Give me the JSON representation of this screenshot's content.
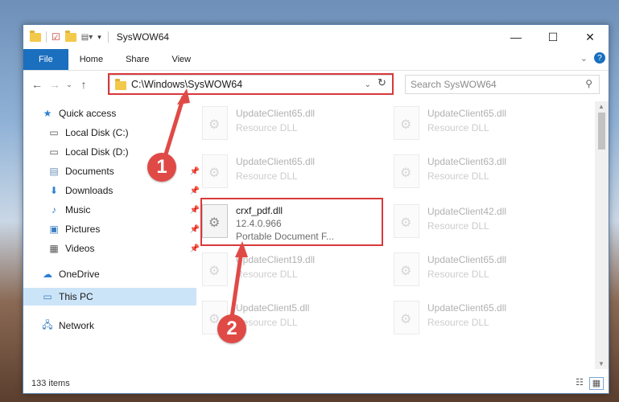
{
  "window": {
    "title": "SysWOW64"
  },
  "ribbon": {
    "tabs": [
      "File",
      "Home",
      "Share",
      "View"
    ]
  },
  "address": {
    "path": "C:\\Windows\\SysWOW64"
  },
  "search": {
    "placeholder": "Search SysWOW64"
  },
  "sidebar": {
    "items": [
      {
        "label": "Quick access",
        "icon": "star-icon",
        "pinned": false
      },
      {
        "label": "Local Disk (C:)",
        "icon": "drive-icon",
        "pinned": false
      },
      {
        "label": "Local Disk (D:)",
        "icon": "drive-icon",
        "pinned": false
      },
      {
        "label": "Documents",
        "icon": "documents-icon",
        "pinned": true
      },
      {
        "label": "Downloads",
        "icon": "download-icon",
        "pinned": true
      },
      {
        "label": "Music",
        "icon": "music-icon",
        "pinned": true
      },
      {
        "label": "Pictures",
        "icon": "pictures-icon",
        "pinned": true
      },
      {
        "label": "Videos",
        "icon": "videos-icon",
        "pinned": true
      },
      {
        "label": "OneDrive",
        "icon": "cloud-icon",
        "pinned": false
      },
      {
        "label": "This PC",
        "icon": "computer-icon",
        "pinned": false,
        "selected": true
      },
      {
        "label": "Network",
        "icon": "network-icon",
        "pinned": false
      }
    ]
  },
  "files": [
    {
      "name": "UpdateClient65.dll",
      "sub": "Resource DLL"
    },
    {
      "name": "UpdateClient65.dll",
      "sub": "Resource DLL"
    },
    {
      "name": "UpdateClient65.dll",
      "sub": "Resource DLL"
    },
    {
      "name": "UpdateClient63.dll",
      "sub": "Resource DLL"
    },
    {
      "name": "crxf_pdf.dll",
      "version": "12.4.0.966",
      "sub": "Portable Document F...",
      "highlighted": true
    },
    {
      "name": "UpdateClient42.dll",
      "sub": "Resource DLL"
    },
    {
      "name": "UpdateClient19.dll",
      "sub": "Resource DLL"
    },
    {
      "name": "UpdateClient65.dll",
      "sub": "Resource DLL"
    },
    {
      "name": "UpdateClient5.dll",
      "sub": "Resource DLL"
    },
    {
      "name": "UpdateClient65.dll",
      "sub": "Resource DLL"
    }
  ],
  "status": {
    "item_count": "133 items"
  },
  "callouts": [
    "1",
    "2"
  ],
  "colors": {
    "accent": "#1a6fbf",
    "highlight": "#d9383a",
    "callout": "#e04a46"
  }
}
